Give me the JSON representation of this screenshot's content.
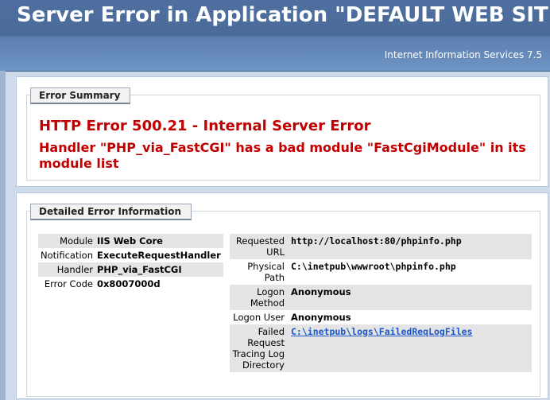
{
  "header": {
    "title": "Server Error in Application \"DEFAULT WEB SITE\"",
    "subtitle": "Internet Information Services 7.5"
  },
  "summary": {
    "legend": "Error Summary",
    "title": "HTTP Error 500.21 - Internal Server Error",
    "message": "Handler \"PHP_via_FastCGI\" has a bad module \"FastCgiModule\" in its module list"
  },
  "detail": {
    "legend": "Detailed Error Information",
    "left": [
      {
        "label": "Module",
        "value": "IIS Web Core"
      },
      {
        "label": "Notification",
        "value": "ExecuteRequestHandler"
      },
      {
        "label": "Handler",
        "value": "PHP_via_FastCGI"
      },
      {
        "label": "Error Code",
        "value": "0x8007000d"
      }
    ],
    "right": [
      {
        "label": "Requested URL",
        "value": "http://localhost:80/phpinfo.php"
      },
      {
        "label": "Physical Path",
        "value": "C:\\inetpub\\wwwroot\\phpinfo.php"
      },
      {
        "label": "Logon Method",
        "value": "Anonymous"
      },
      {
        "label": "Logon User",
        "value": "Anonymous"
      },
      {
        "label": "Failed Request Tracing Log Directory",
        "value": "C:\\inetpub\\logs\\FailedReqLogFiles"
      }
    ]
  },
  "colors": {
    "header_bg": "#4a6a99",
    "error_red": "#c00000",
    "link_blue": "#1a56c8",
    "row_shade": "#e4e4e4"
  }
}
